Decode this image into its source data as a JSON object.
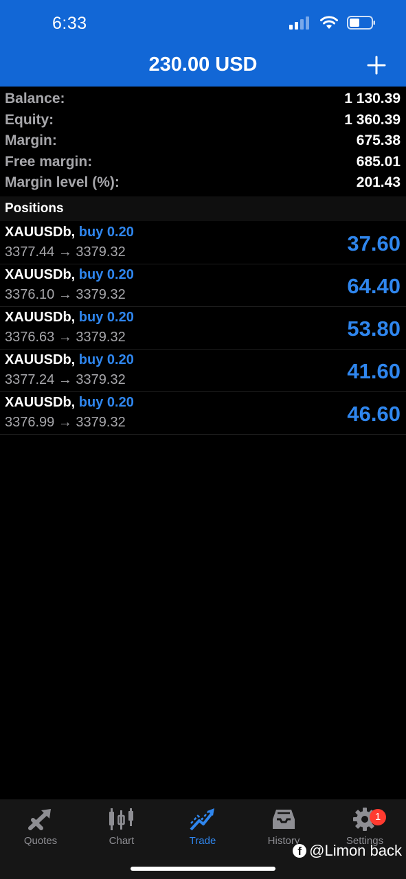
{
  "status_bar": {
    "time": "6:33"
  },
  "header": {
    "title": "230.00 USD",
    "add_icon": "plus-icon"
  },
  "summary": [
    {
      "label": "Balance:",
      "value": "1 130.39"
    },
    {
      "label": "Equity:",
      "value": "1 360.39"
    },
    {
      "label": "Margin:",
      "value": "675.38"
    },
    {
      "label": "Free margin:",
      "value": "685.01"
    },
    {
      "label": "Margin level (%):",
      "value": "201.43"
    }
  ],
  "positions_header": "Positions",
  "positions": [
    {
      "symbol": "XAUUSDb,",
      "side": "buy 0.20",
      "prices": "3377.44 → 3379.32",
      "profit": "37.60"
    },
    {
      "symbol": "XAUUSDb,",
      "side": "buy 0.20",
      "prices": "3376.10 → 3379.32",
      "profit": "64.40"
    },
    {
      "symbol": "XAUUSDb,",
      "side": "buy 0.20",
      "prices": "3376.63 → 3379.32",
      "profit": "53.80"
    },
    {
      "symbol": "XAUUSDb,",
      "side": "buy 0.20",
      "prices": "3377.24 → 3379.32",
      "profit": "41.60"
    },
    {
      "symbol": "XAUUSDb,",
      "side": "buy 0.20",
      "prices": "3376.99 → 3379.32",
      "profit": "46.60"
    }
  ],
  "tabs": [
    {
      "label": "Quotes",
      "icon": "quotes-arrows-icon"
    },
    {
      "label": "Chart",
      "icon": "candlestick-icon"
    },
    {
      "label": "Trade",
      "icon": "trade-trend-icon",
      "active": true
    },
    {
      "label": "History",
      "icon": "inbox-tray-icon"
    },
    {
      "label": "Settings",
      "icon": "gear-icon",
      "badge": "1"
    }
  ],
  "watermark": "@Limon back",
  "colors": {
    "header_bg": "#1267d6",
    "accent": "#2f86ee",
    "badge": "#ff3b30"
  }
}
